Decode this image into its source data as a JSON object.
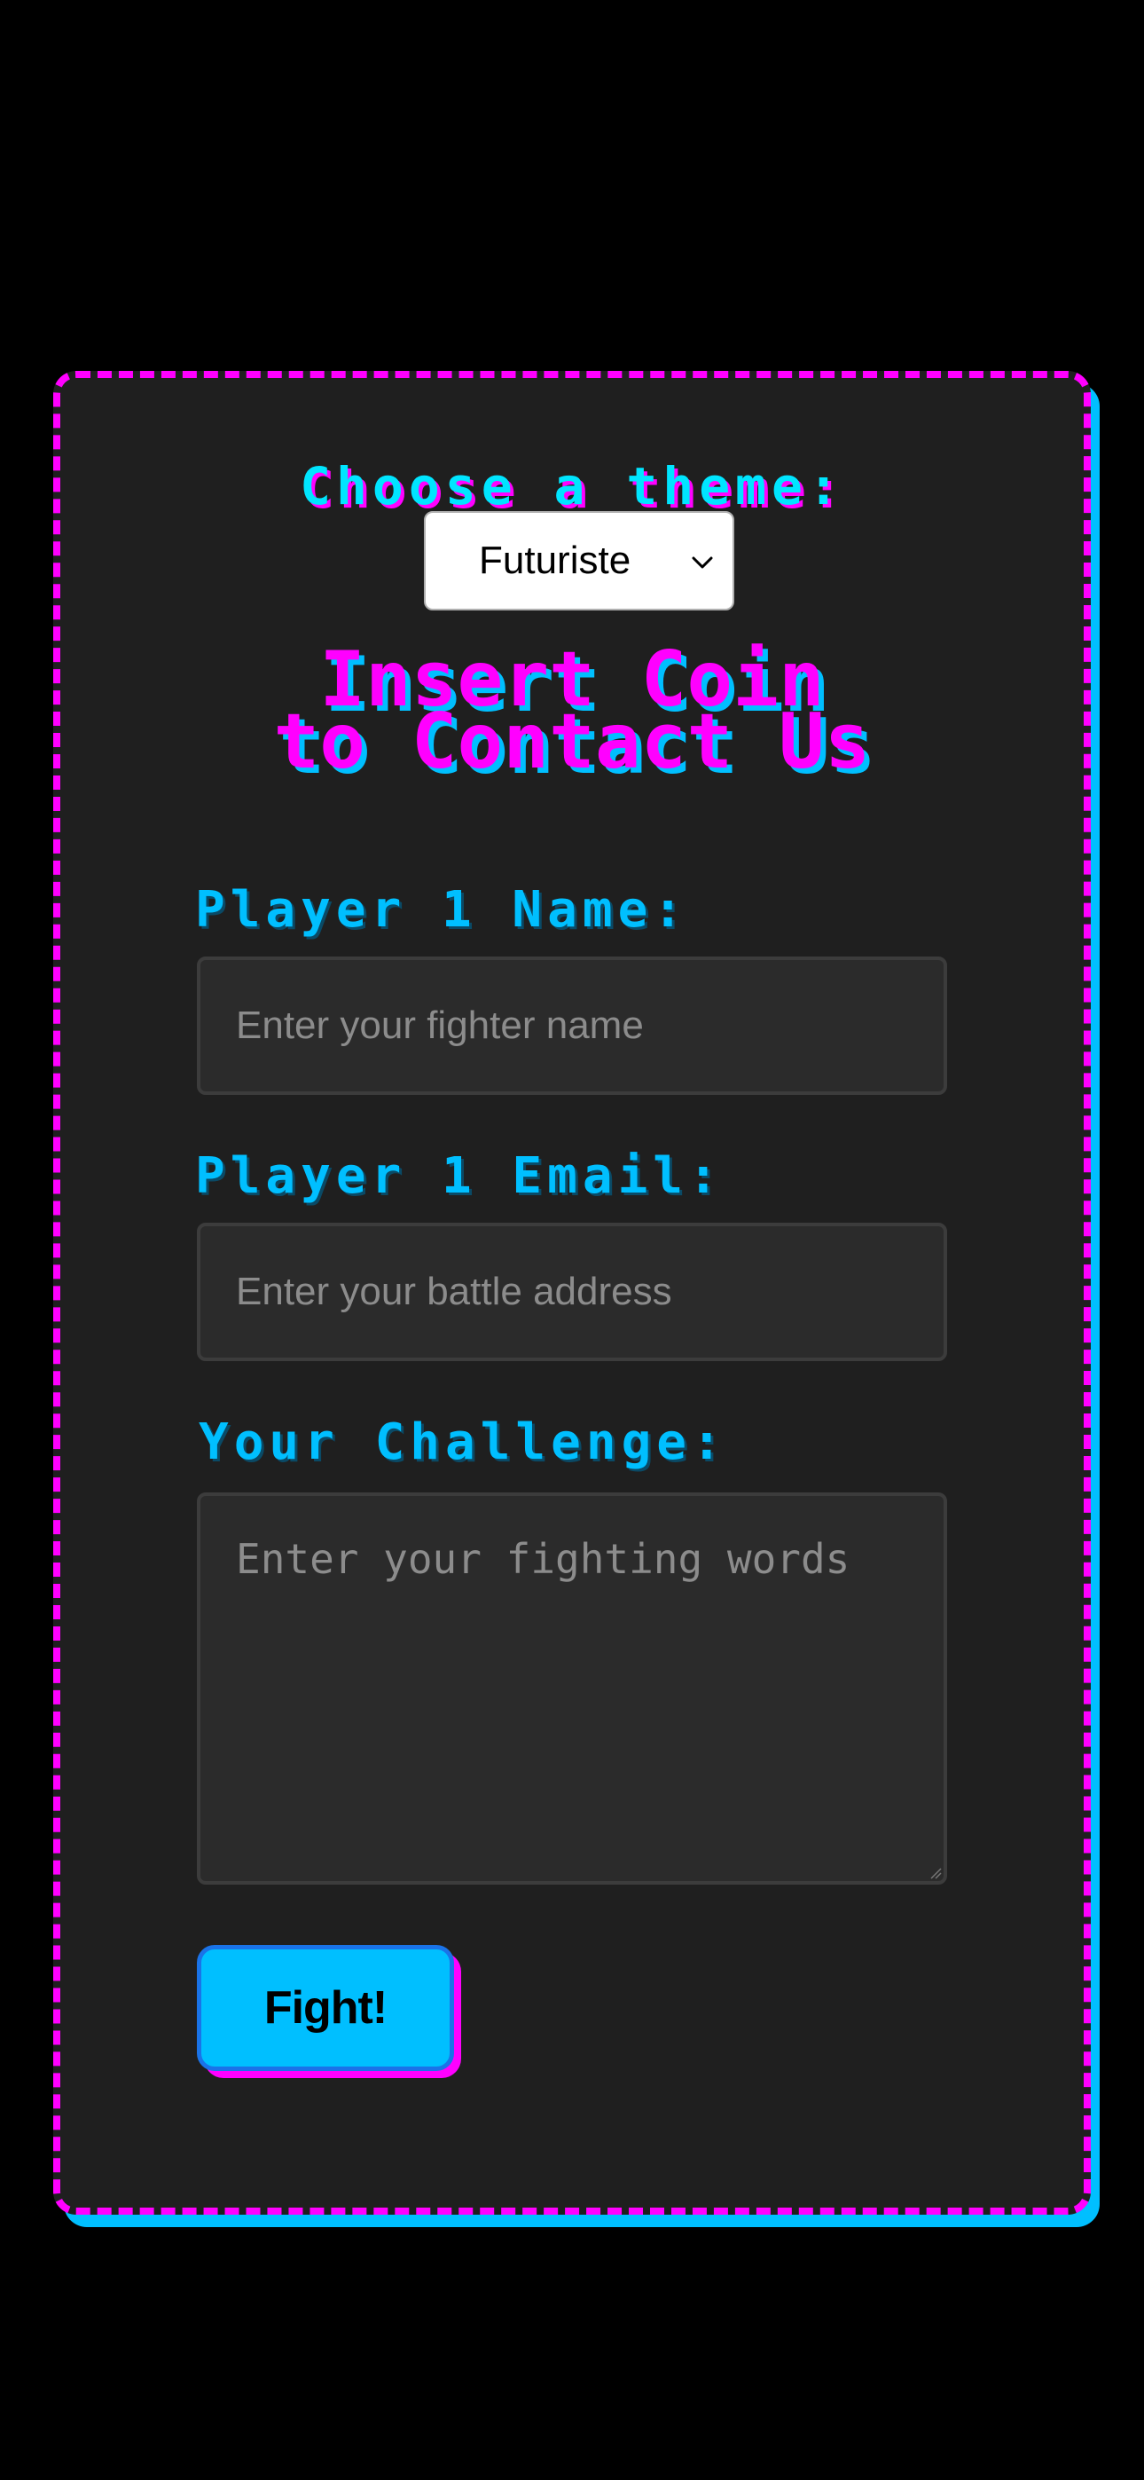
{
  "theme_picker": {
    "label": "Choose a theme:",
    "selected": "Futuriste"
  },
  "title": {
    "line1": "Insert Coin",
    "line2": "to Contact Us"
  },
  "form": {
    "name_label": "Player 1 Name:",
    "name_placeholder": "Enter your fighter name",
    "email_label": "Player 1 Email:",
    "email_placeholder": "Enter your battle address",
    "message_label": "Your Challenge:",
    "message_placeholder": "Enter your fighting words",
    "submit_label": "Fight!"
  },
  "colors": {
    "background": "#000000",
    "card": "#1f1f1f",
    "magenta": "#ff00ff",
    "cyan": "#00bfff",
    "field": "#2b2b2b"
  },
  "icons": {
    "select_arrow": "chevron-down-icon",
    "textarea_corner": "resize-handle-icon"
  }
}
